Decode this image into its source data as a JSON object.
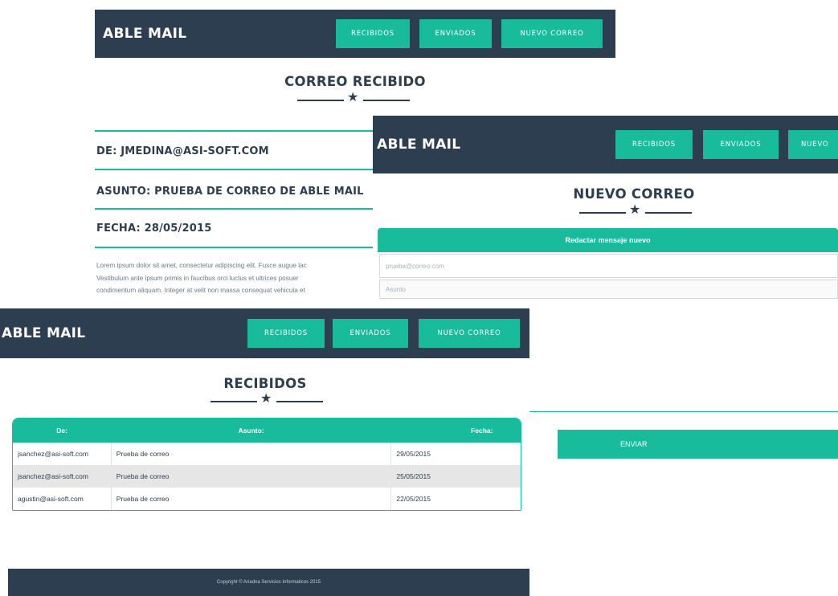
{
  "brand": "ABLE MAIL",
  "nav": {
    "received": "RECIBIDOS",
    "sent": "ENVIADOS",
    "new_mail": "NUEVO CORREO",
    "new_mail_cut": "NUEVO"
  },
  "received_view": {
    "title": "CORREO RECIBIDO",
    "from": "DE: JMEDINA@ASI-SOFT.COM",
    "subject": "ASUNTO: PRUEBA DE CORREO DE ABLE MAIL",
    "date": "FECHA: 28/05/2015",
    "body_lines": [
      "Lorem ipsum dolor sit amet, consectetur adipiscing elit. Fusce augue lac",
      "Vestibulum ante ipsum primis in faucibus orci luctus et ultrices posuer",
      "condimentum aliquam. Integer at velit non massa consequat vehicula et"
    ]
  },
  "compose_view": {
    "title": "NUEVO CORREO",
    "panel_title": "Redactar mensaje nuevo",
    "to_placeholder": "prueba@correo.com",
    "subject_placeholder": "Asunto",
    "send_label": "ENVIAR"
  },
  "inbox_view": {
    "title": "RECIBIDOS",
    "columns": [
      "De:",
      "Asunto:",
      "Fecha:"
    ],
    "rows": [
      [
        "jsanchez@asi-soft.com",
        "Prueba de correo",
        "29/05/2015"
      ],
      [
        "jsanchez@asi-soft.com",
        "Prueba de correo",
        "25/05/2015"
      ],
      [
        "agustin@asi-soft.com",
        "Prueba de correo",
        "22/05/2015"
      ]
    ],
    "footer": "Copyright © Ariadna Servicios Informaticos 2015"
  },
  "colors": {
    "navy": "#2c3e50",
    "teal": "#18bc9c"
  }
}
